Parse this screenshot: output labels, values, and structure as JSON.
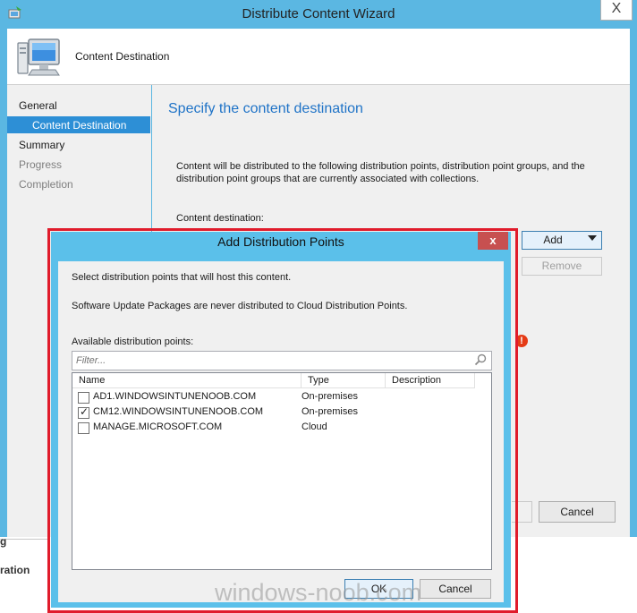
{
  "wizard": {
    "title": "Distribute Content Wizard",
    "close_glyph": "X",
    "header_label": "Content Destination",
    "nav": [
      {
        "label": "General",
        "state": "normal"
      },
      {
        "label": "Content Destination",
        "state": "selected"
      },
      {
        "label": "Summary",
        "state": "normal"
      },
      {
        "label": "Progress",
        "state": "disabled"
      },
      {
        "label": "Completion",
        "state": "disabled"
      }
    ],
    "heading": "Specify the content destination",
    "description": "Content will be distributed to the following distribution points, distribution point groups, and the distribution point groups that are currently associated with collections.",
    "destination_label": "Content destination:",
    "add_label": "Add",
    "remove_label": "Remove",
    "cancel_label": "Cancel",
    "error_glyph": "!"
  },
  "background_app": {
    "fragment_1": "g",
    "fragment_2": "ration"
  },
  "dialog": {
    "title": "Add Distribution Points",
    "close_glyph": "x",
    "instruction": "Select distribution points that will host this content.",
    "note": "Software Update Packages are never distributed to Cloud Distribution Points.",
    "available_label": "Available distribution points:",
    "filter_placeholder": "Filter...",
    "columns": [
      "Name",
      "Type",
      "Description"
    ],
    "rows": [
      {
        "name": "AD1.WINDOWSINTUNENOOB.COM",
        "type": "On-premises",
        "checked": false
      },
      {
        "name": "CM12.WINDOWSINTUNENOOB.COM",
        "type": "On-premises",
        "checked": true
      },
      {
        "name": "MANAGE.MICROSOFT.COM",
        "type": "Cloud",
        "checked": false
      }
    ],
    "ok_label": "OK",
    "cancel_label": "Cancel",
    "check_glyph": "✓"
  },
  "watermark": "windows-noob.com",
  "colors": {
    "title_bar": "#5bb7e2",
    "selection": "#2d8fd6",
    "heading": "#1f73c7",
    "highlight_outline": "#e01b2b",
    "close_button": "#c75050"
  }
}
